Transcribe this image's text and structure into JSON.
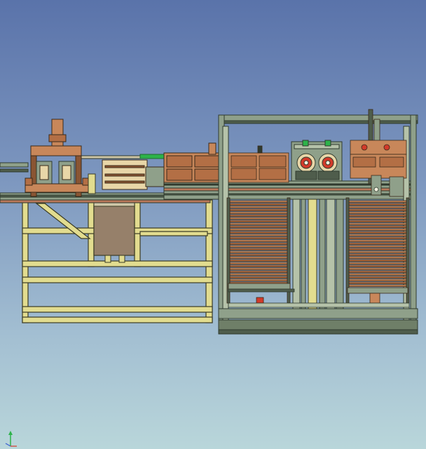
{
  "viewport": {
    "background_top": "#5a73aa",
    "background_bottom": "#b9d6da"
  },
  "palette": {
    "frame": "#e2dc8f",
    "frame_edge": "#3b3b25",
    "wood": "#c8875a",
    "wood_dark": "#8a5533",
    "steel": "#8fa08a",
    "steel_dark": "#4f5d4c",
    "panel": "#96806a",
    "red": "#d23a2a",
    "cream": "#e8d6a8",
    "green_axis": "#2db34a"
  },
  "axis_triad": {
    "icon": "xyz-axis-triad-icon"
  }
}
